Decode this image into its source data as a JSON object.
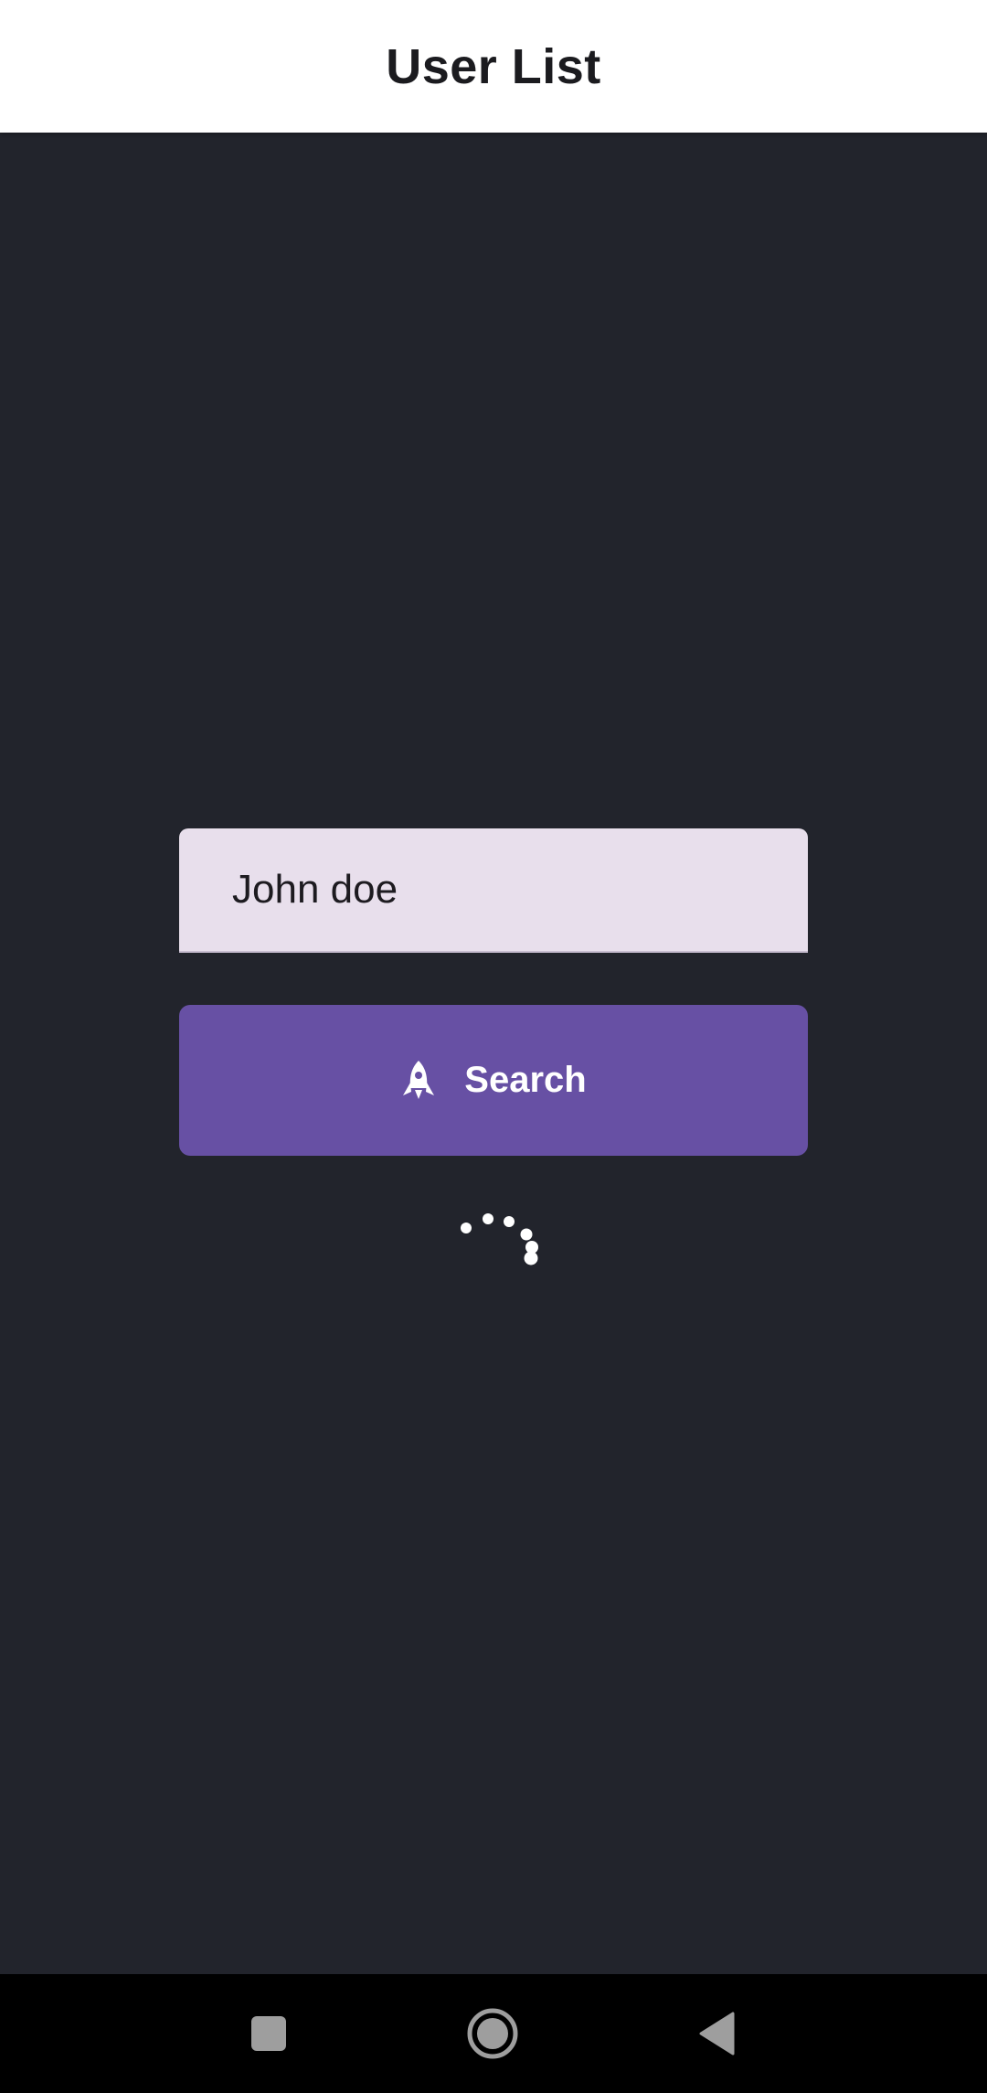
{
  "app_bar": {
    "title": "User List"
  },
  "search": {
    "input_value": "John doe",
    "button_label": "Search",
    "button_icon": "rocket-icon"
  },
  "status": {
    "loading": true
  },
  "nav_bar": {
    "recents_icon": "square-icon",
    "home_icon": "circle-icon",
    "back_icon": "triangle-back-icon"
  },
  "colors": {
    "background": "#22242c",
    "app_bar": "#ffffff",
    "field": "#e8dfec",
    "primary": "#6750a4",
    "on_primary": "#ffffff",
    "nav_bar": "#000000"
  }
}
